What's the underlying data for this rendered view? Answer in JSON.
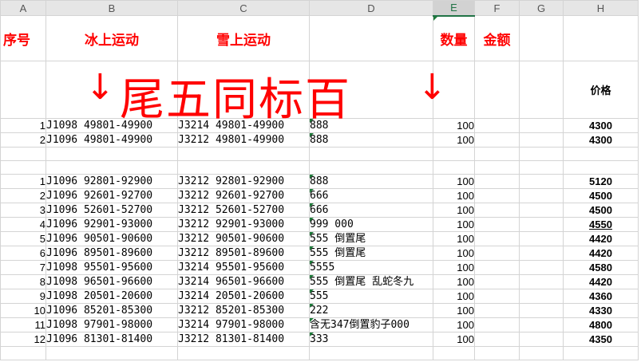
{
  "columns": [
    "A",
    "B",
    "C",
    "D",
    "E",
    "F",
    "G",
    "H"
  ],
  "header": {
    "seq": "序号",
    "ice": "冰上运动",
    "snow": "雪上运动",
    "qty": "数量",
    "amount": "金额"
  },
  "banner": {
    "text": "尾五同标百",
    "price_label": "价格",
    "arrow_left": "↓",
    "arrow_right": "↓"
  },
  "group1": [
    {
      "idx": "1",
      "b": "J1098 49801-49900",
      "c": "J3214 49801-49900",
      "d": "888",
      "qty": "100",
      "price": "4300"
    },
    {
      "idx": "2",
      "b": "J1096 49801-49900",
      "c": "J3212 49801-49900",
      "d": "888",
      "qty": "100",
      "price": "4300"
    }
  ],
  "group2": [
    {
      "idx": "1",
      "b": "J1096 92801-92900",
      "c": "J3212 92801-92900",
      "d": "888",
      "qty": "100",
      "price": "5120"
    },
    {
      "idx": "2",
      "b": "J1096 92601-92700",
      "c": "J3212 92601-92700",
      "d": "666",
      "qty": "100",
      "price": "4500"
    },
    {
      "idx": "3",
      "b": "J1096 52601-52700",
      "c": "J3212 52601-52700",
      "d": "666",
      "qty": "100",
      "price": "4500"
    },
    {
      "idx": "4",
      "b": "J1096 92901-93000",
      "c": "J3212 92901-93000",
      "d": "999   000",
      "qty": "100",
      "price": "4550"
    },
    {
      "idx": "5",
      "b": "J1096 90501-90600",
      "c": "J3212 90501-90600",
      "d": "555  倒置尾",
      "qty": "100",
      "price": "4420"
    },
    {
      "idx": "6",
      "b": "J1096 89501-89600",
      "c": "J3212 89501-89600",
      "d": "555  倒置尾",
      "qty": "100",
      "price": "4420"
    },
    {
      "idx": "7",
      "b": "J1098 95501-95600",
      "c": "J3214 95501-95600",
      "d": "5555",
      "qty": "100",
      "price": "4580"
    },
    {
      "idx": "8",
      "b": "J1098 96501-96600",
      "c": "J3214 96501-96600",
      "d": "555  倒置尾 乱蛇冬九",
      "qty": "100",
      "price": "4420"
    },
    {
      "idx": "9",
      "b": "J1098 20501-20600",
      "c": "J3214 20501-20600",
      "d": "555",
      "qty": "100",
      "price": "4360"
    },
    {
      "idx": "10",
      "b": "J1096 85201-85300",
      "c": "J3212 85201-85300",
      "d": "222",
      "qty": "100",
      "price": "4330"
    },
    {
      "idx": "11",
      "b": "J1098 97901-98000",
      "c": "J3214 97901-98000",
      "d": "含无347倒置豹子000",
      "qty": "100",
      "price": "4800"
    },
    {
      "idx": "12",
      "b": "J1096 81301-81400",
      "c": "J3212 81301-81400",
      "d": "333",
      "qty": "100",
      "price": "4350"
    }
  ],
  "colors": {
    "accent": "#ff0000",
    "selection": "#217346",
    "gridline": "#d4d4d4"
  }
}
